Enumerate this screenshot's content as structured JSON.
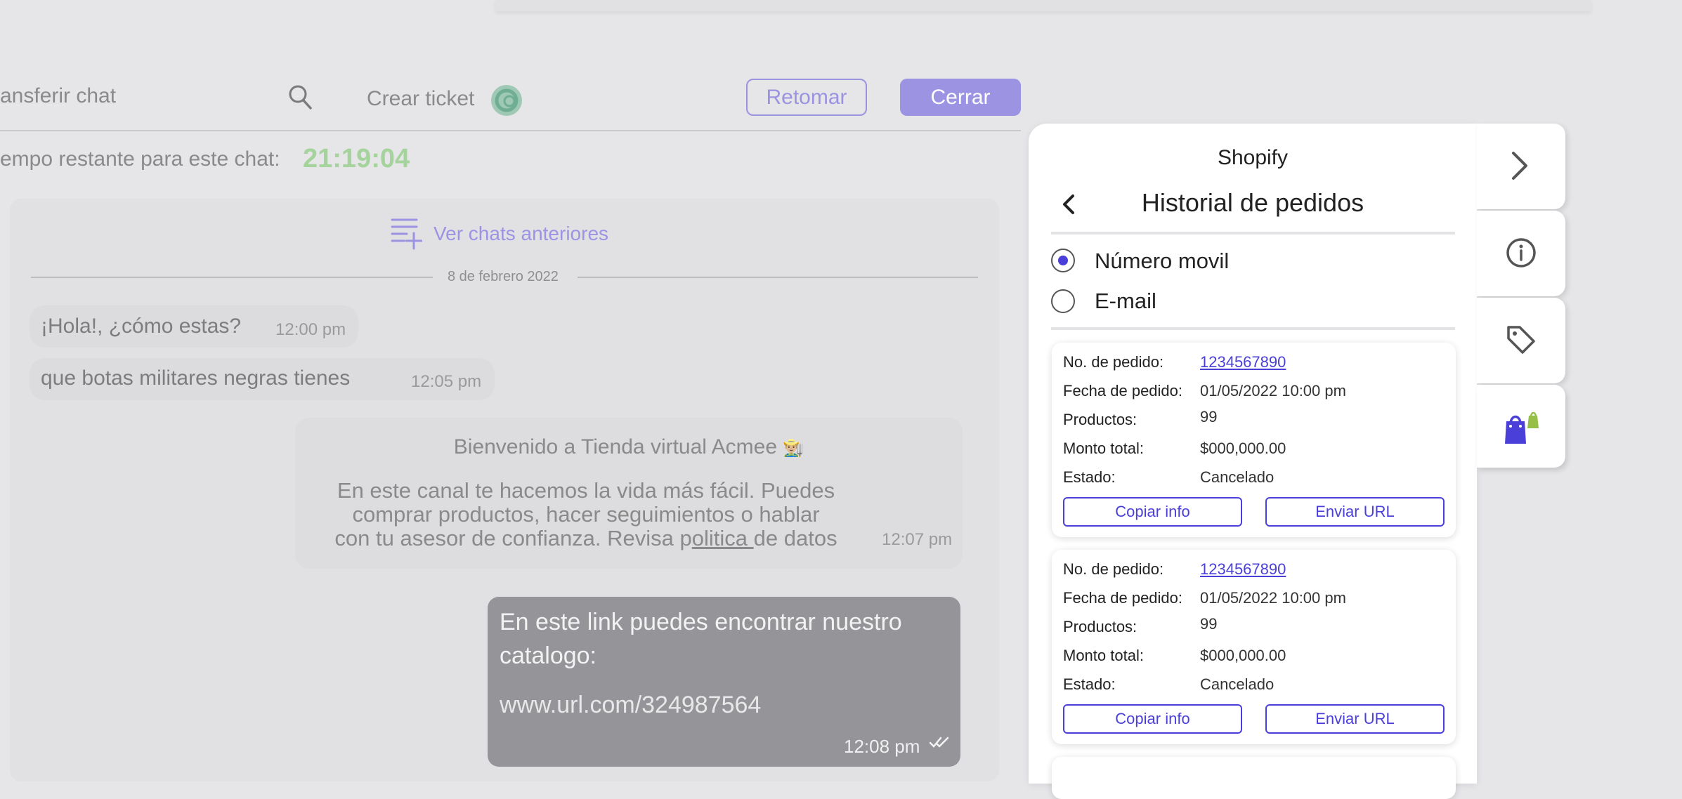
{
  "header": {
    "transfer_label": "ansferir chat",
    "create_ticket_label": "Crear ticket",
    "retomar_label": "Retomar",
    "cerrar_label": "Cerrar",
    "remaining_label": "empo restante para este chat:",
    "remaining_time": "21:19:04"
  },
  "chat": {
    "view_previous_label": "Ver chats anteriores",
    "date_divider": "8 de febrero 2022",
    "messages": [
      {
        "text": "¡Hola!, ¿cómo estas?",
        "time": "12:00 pm"
      },
      {
        "text": "que botas militares negras tienes",
        "time": "12:05 pm"
      }
    ],
    "system_message": {
      "title": "Bienvenido a Tienda virtual Acmee",
      "emoji": "👨🏼‍🌾",
      "line1": "En este canal te hacemos la vida más fácil. Puedes",
      "line2": "comprar productos, hacer seguimientos o hablar",
      "line3_a": "con tu asesor de confianza. Revisa p",
      "line3_link": "olitica ",
      "line3_b": "de datos",
      "time": "12:07 pm"
    },
    "outgoing": {
      "line1": "En este link puedes encontrar nuestro",
      "line2": "catalogo:",
      "url": "www.url.com/324987564",
      "time": "12:08 pm"
    }
  },
  "panel": {
    "source": "Shopify",
    "title": "Historial de pedidos",
    "options": [
      {
        "label": "Número movil",
        "selected": true
      },
      {
        "label": "E-mail",
        "selected": false
      }
    ],
    "labels": {
      "order_no": "No. de pedido:",
      "order_date": "Fecha de pedido:",
      "products": "Productos:",
      "total": "Monto total:",
      "status": "Estado:"
    },
    "orders": [
      {
        "order_no": "1234567890",
        "date": "01/05/2022 10:00 pm",
        "products": "99",
        "total": "$000,000.00",
        "status": "Cancelado",
        "copy": "Copiar info",
        "send": "Enviar URL"
      },
      {
        "order_no": "1234567890",
        "date": "01/05/2022 10:00 pm",
        "products": "99",
        "total": "$000,000.00",
        "status": "Cancelado",
        "copy": "Copiar info",
        "send": "Enviar URL"
      }
    ]
  },
  "sidebar": {
    "icons": [
      "chevron-right-icon",
      "info-icon",
      "tag-icon",
      "shopify-bag-icon"
    ]
  },
  "colors": {
    "accent": "#4b3fd9",
    "accent_soft": "#9c93e3",
    "timer": "#a4d39c"
  }
}
